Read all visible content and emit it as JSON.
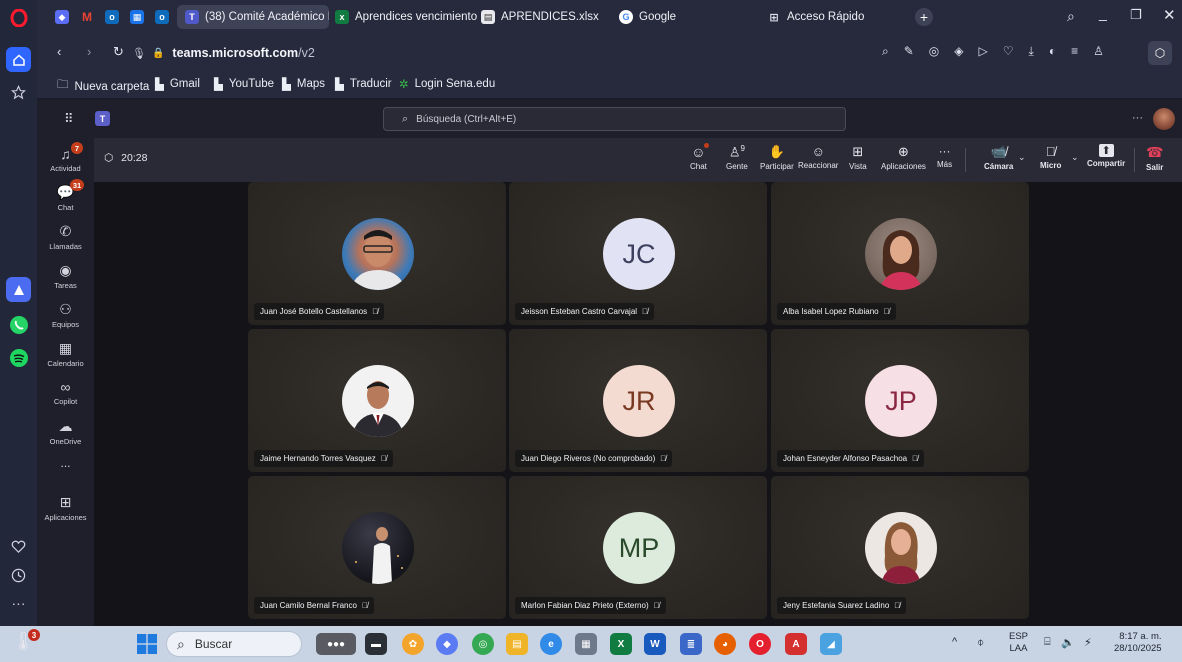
{
  "browser": {
    "tabs": [
      {
        "label": "(38) Comité Académico Et",
        "active": true
      },
      {
        "label": "Aprendices vencimiento t",
        "active": false
      },
      {
        "label": "APRENDICES.xlsx",
        "active": false
      },
      {
        "label": "Google",
        "active": false
      },
      {
        "label": "Acceso Rápido",
        "active": false
      }
    ],
    "url_domain": "teams.microsoft.com",
    "url_path": "/v2",
    "bookmarks": [
      "Nueva carpeta",
      "Gmail",
      "YouTube",
      "Maps",
      "Traducir",
      "Login Sena.edu"
    ]
  },
  "teams": {
    "search_placeholder": "Búsqueda (Ctrl+Alt+E)",
    "rail": [
      {
        "label": "Actividad",
        "icon": "bell-icon",
        "badge": "7"
      },
      {
        "label": "Chat",
        "icon": "chat-icon",
        "badge": "31"
      },
      {
        "label": "Llamadas",
        "icon": "phone-icon"
      },
      {
        "label": "Tareas",
        "icon": "tasks-icon"
      },
      {
        "label": "Equipos",
        "icon": "teams-icon"
      },
      {
        "label": "Calendario",
        "icon": "calendar-icon"
      },
      {
        "label": "Copilot",
        "icon": "copilot-icon"
      },
      {
        "label": "OneDrive",
        "icon": "cloud-icon"
      },
      {
        "label": "...",
        "icon": "more-icon"
      },
      {
        "label": "Aplicaciones",
        "icon": "plus-icon"
      }
    ],
    "meeting": {
      "timer": "20:28",
      "tools": [
        "Chat",
        "Gente",
        "Participar",
        "Reaccionar",
        "Vista",
        "Aplicaciones",
        "Más"
      ],
      "people_count": "9",
      "camera_label": "Cámara",
      "mic_label": "Micro",
      "share_label": "Compartir",
      "leave_label": "Salir"
    },
    "participants": [
      {
        "name": "Juan José Botello Castellanos",
        "initials": "",
        "photo": true,
        "bg": "#3d7ab8"
      },
      {
        "name": "Jeisson Esteban Castro Carvajal",
        "initials": "JC",
        "photo": false,
        "bg": "#e1e3f4",
        "fg": "#3c3f5e"
      },
      {
        "name": "Alba Isabel Lopez Rubiano",
        "initials": "",
        "photo": true,
        "bg": "#8b7c74"
      },
      {
        "name": "Jaime Hernando Torres Vasquez",
        "initials": "",
        "photo": true,
        "bg": "#f0f0f0"
      },
      {
        "name": "Juan Diego Riveros (No comprobado)",
        "initials": "JR",
        "photo": false,
        "bg": "#f3dbd2",
        "fg": "#7a3a22"
      },
      {
        "name": "Johan Esneyder Alfonso Pasachoa",
        "initials": "JP",
        "photo": false,
        "bg": "#f7dfe6",
        "fg": "#8a2742"
      },
      {
        "name": "Juan Camilo Bernal Franco",
        "initials": "",
        "photo": true,
        "bg": "#15161c"
      },
      {
        "name": "Marlon Fabian Diaz Prieto (Externo)",
        "initials": "MP",
        "photo": false,
        "bg": "#dcebdc",
        "fg": "#2b4a2b"
      },
      {
        "name": "Jeny Estefania Suarez Ladino",
        "initials": "",
        "photo": true,
        "bg": "#e9e4df"
      }
    ]
  },
  "taskbar": {
    "search_label": "Buscar",
    "weather_badge": "3",
    "lang_line1": "ESP",
    "lang_line2": "LAA",
    "time": "8:17 a. m.",
    "date": "28/10/2025"
  },
  "colors": {
    "opera_red": "#ff1b2d",
    "teams_purple": "#6264a7",
    "leave_red": "#c4314b",
    "badge_red": "#c43e1c"
  }
}
